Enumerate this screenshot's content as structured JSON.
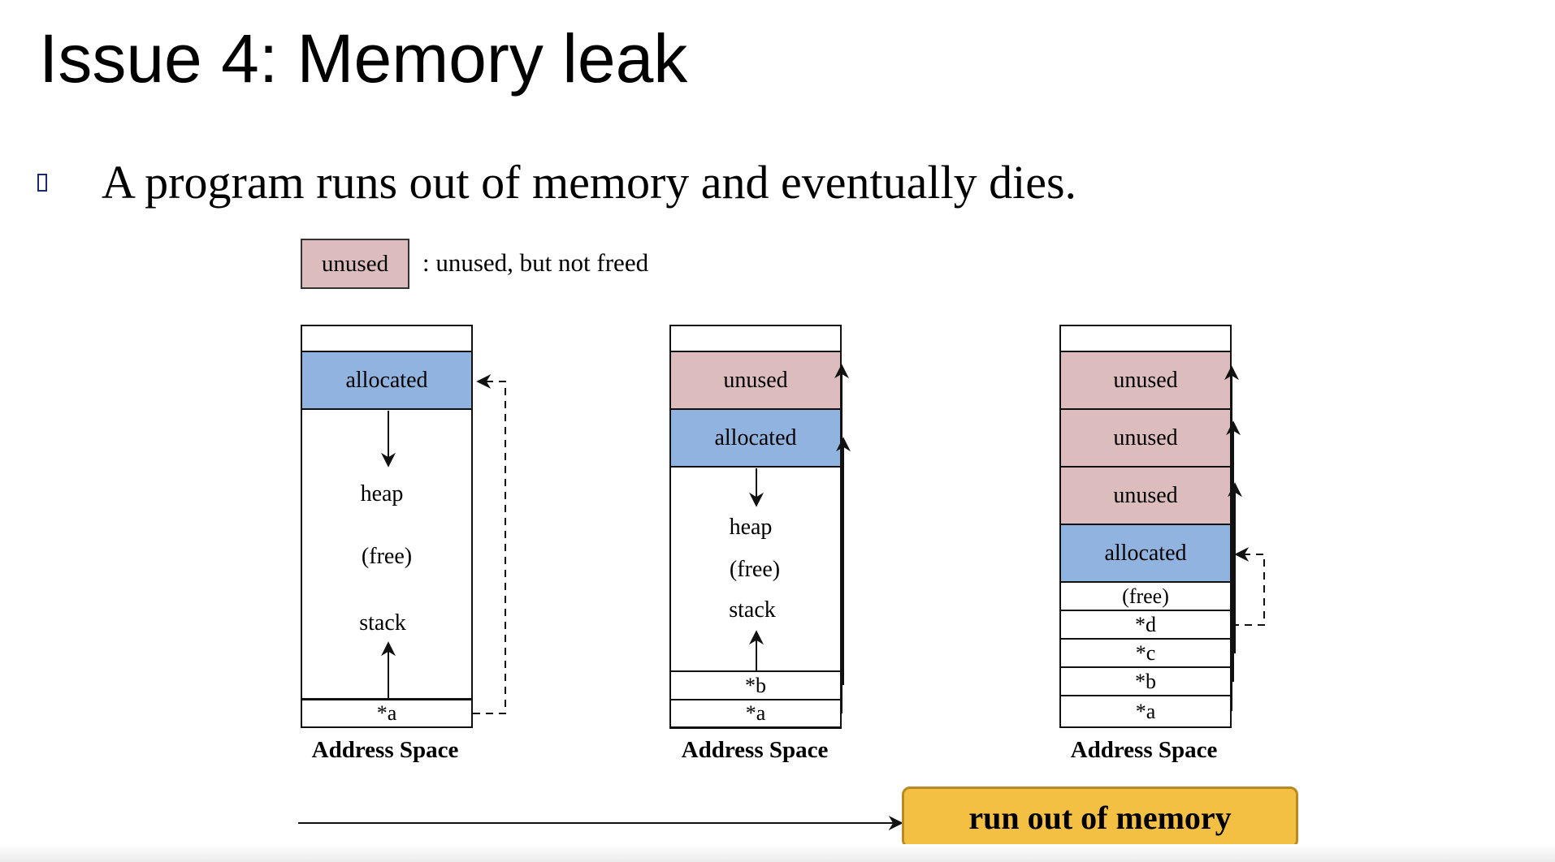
{
  "title": "Issue 4: Memory leak",
  "bullet": "A program runs out of memory and eventually dies.",
  "legend": {
    "swatch_label": "unused",
    "description": ": unused, but not freed"
  },
  "panels": [
    {
      "blocks": [
        "allocated"
      ],
      "heap_label": "heap",
      "free_label": "(free)",
      "stack_label": "stack",
      "stack_items": [
        "*a"
      ],
      "caption": "Address Space"
    },
    {
      "blocks": [
        "unused",
        "allocated"
      ],
      "heap_label": "heap",
      "free_label": "(free)",
      "stack_label": "stack",
      "stack_items": [
        "*b",
        "*a"
      ],
      "caption": "Address Space"
    },
    {
      "blocks": [
        "unused",
        "unused",
        "unused",
        "allocated"
      ],
      "free_label": "(free)",
      "stack_items": [
        "*d",
        "*c",
        "*b",
        "*a"
      ],
      "caption": "Address Space"
    }
  ],
  "outcome": "run out of memory",
  "colors": {
    "unused": "#dcbcbc",
    "allocated": "#91b3e0",
    "outcome_fill": "#f4c043"
  }
}
